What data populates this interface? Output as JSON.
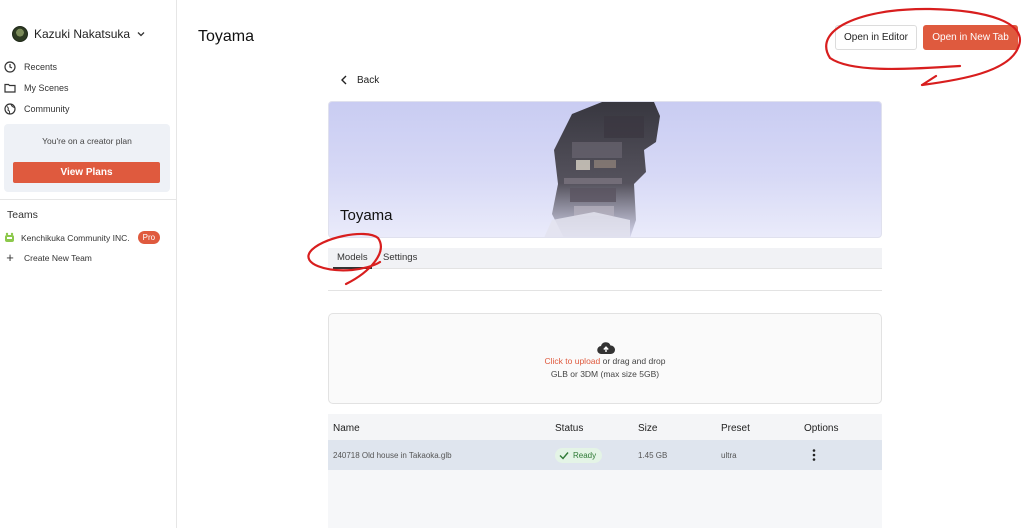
{
  "user": {
    "name": "Kazuki Nakatsuka"
  },
  "nav": [
    {
      "label": "Recents",
      "icon": "clock-icon"
    },
    {
      "label": "My Scenes",
      "icon": "folder-icon"
    },
    {
      "label": "Community",
      "icon": "globe-icon"
    }
  ],
  "plan": {
    "text": "You're on a creator plan",
    "button": "View Plans"
  },
  "teams": {
    "title": "Teams",
    "items": [
      {
        "name": "Kenchikuka Community INC.",
        "badge": "Pro"
      }
    ],
    "create_label": "Create New Team"
  },
  "header": {
    "title": "Toyama",
    "open_editor": "Open in Editor",
    "open_new_tab": "Open in New Tab"
  },
  "back_label": "Back",
  "banner": {
    "title": "Toyama"
  },
  "tabs": [
    {
      "label": "Models",
      "active": true
    },
    {
      "label": "Settings",
      "active": false
    }
  ],
  "upload": {
    "link": "Click to upload",
    "text": "or drag and drop",
    "hint": "GLB or 3DM (max size 5GB)"
  },
  "table": {
    "columns": [
      "Name",
      "Status",
      "Size",
      "Preset",
      "Options"
    ],
    "rows": [
      {
        "name": "240718 Old house in Takaoka.glb",
        "status": "Ready",
        "size": "1.45 GB",
        "preset": "ultra"
      }
    ]
  },
  "colors": {
    "accent": "#df5a3e",
    "annotation": "#d81e1e",
    "banner": "#c9ccf2"
  }
}
